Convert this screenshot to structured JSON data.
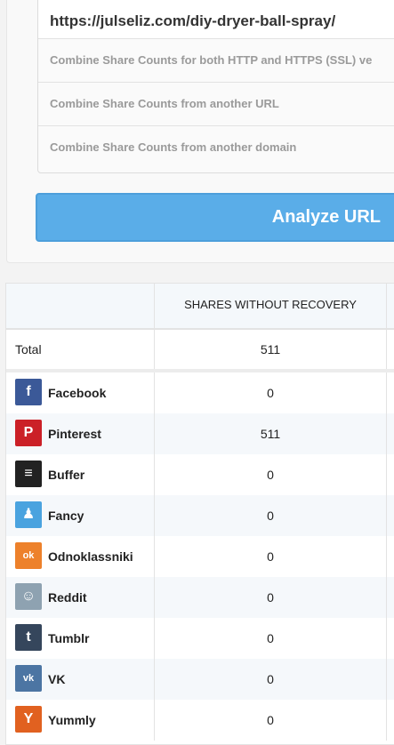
{
  "form": {
    "url_value": "https://julseliz.com/diy-dryer-ball-spray/",
    "options": [
      "Combine Share Counts for both HTTP and HTTPS (SSL) ve",
      "Combine Share Counts from another URL",
      "Combine Share Counts from another domain"
    ],
    "analyze_label": "Analyze URL"
  },
  "table": {
    "column_header": "SHARES WITHOUT RECOVERY",
    "total": {
      "label": "Total",
      "value": "511"
    },
    "rows": [
      {
        "label": "Facebook",
        "value": "0",
        "icon": "facebook-icon",
        "color": "#3b5998",
        "glyph": "f"
      },
      {
        "label": "Pinterest",
        "value": "511",
        "icon": "pinterest-icon",
        "color": "#cb2027",
        "glyph": "P"
      },
      {
        "label": "Buffer",
        "value": "0",
        "icon": "buffer-icon",
        "color": "#222222",
        "glyph": "≡"
      },
      {
        "label": "Fancy",
        "value": "0",
        "icon": "fancy-icon",
        "color": "#4aa3df",
        "glyph": "♟"
      },
      {
        "label": "Odnoklassniki",
        "value": "0",
        "icon": "odnoklassniki-icon",
        "color": "#ed812b",
        "glyph": "ok"
      },
      {
        "label": "Reddit",
        "value": "0",
        "icon": "reddit-icon",
        "color": "#8ea2b1",
        "glyph": "☺"
      },
      {
        "label": "Tumblr",
        "value": "0",
        "icon": "tumblr-icon",
        "color": "#35465c",
        "glyph": "t"
      },
      {
        "label": "VK",
        "value": "0",
        "icon": "vk-icon",
        "color": "#4c75a3",
        "glyph": "vk"
      },
      {
        "label": "Yummly",
        "value": "0",
        "icon": "yummly-icon",
        "color": "#e16120",
        "glyph": "Y"
      }
    ]
  }
}
